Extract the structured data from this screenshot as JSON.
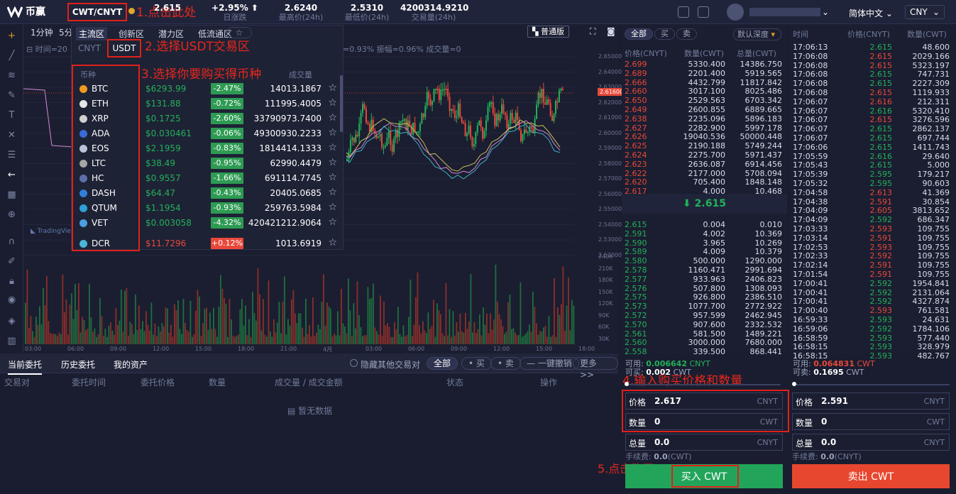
{
  "header": {
    "logo_text": "币赢",
    "pair": "CWT/CNYT",
    "last_price": "2.615",
    "change": "+2.95%",
    "change_label": "日涨跌",
    "high": "2.6240",
    "high_label": "最高价(24h)",
    "low": "2.5310",
    "low_label": "最低价(24h)",
    "volume": "4200314.9210",
    "volume_label": "交易量(24h)",
    "language": "简体中文",
    "currency": "CNY"
  },
  "annotations": {
    "step1": "1.点击此处",
    "step2": "2.选择USDT交易区",
    "step3": "3.选择你要购买得币种",
    "step4": "4.输入购买价格和数量",
    "step5": "5.点击购买"
  },
  "chart": {
    "timeframes": [
      "1分钟",
      "5分"
    ],
    "view_button": "普通版",
    "info_prefix": "时间=20",
    "ohlc_info": "=0.93%  振幅=0.96%  成交量=0",
    "current_price_tag": "2.61600",
    "price_axis": [
      "2.65000",
      "2.64000",
      "2.63000",
      "2.62000",
      "2.61000",
      "2.60000",
      "2.59000",
      "2.58000",
      "2.57000",
      "2.56000",
      "2.55000",
      "2.54000",
      "2.53000",
      "2.52000"
    ],
    "vol_axis": [
      "240K",
      "210K",
      "180K",
      "150K",
      "120K",
      "90K",
      "60K",
      "30K"
    ],
    "time_axis": [
      "03:00",
      "06:00",
      "09:00",
      "12:00",
      "15:00",
      "18:00",
      "21:00",
      "4月",
      "03:00",
      "06:00",
      "09:00",
      "12:00",
      "15:00",
      "18:00"
    ],
    "tv_logo": "TradingView"
  },
  "market": {
    "tabs": [
      "主流区",
      "创新区",
      "潜力区",
      "低流通区"
    ],
    "subtabs": [
      "CNYT",
      "USDT"
    ],
    "col_coin": "币种",
    "col_volume": "成交量",
    "rows": [
      {
        "name": "BTC",
        "price": "$6293.99",
        "change": "-2.47%",
        "volume": "14013.1867",
        "dir": "down",
        "color": "#f09a20"
      },
      {
        "name": "ETH",
        "price": "$131.88",
        "change": "-0.72%",
        "volume": "111995.4005",
        "dir": "down",
        "color": "#e6e6e6"
      },
      {
        "name": "XRP",
        "price": "$0.1725",
        "change": "-2.60%",
        "volume": "33790973.7400",
        "dir": "down",
        "color": "#d0d0d0"
      },
      {
        "name": "ADA",
        "price": "$0.030461",
        "change": "-0.06%",
        "volume": "49300930.2233",
        "dir": "down",
        "color": "#3a6bd8"
      },
      {
        "name": "EOS",
        "price": "$2.1959",
        "change": "-0.83%",
        "volume": "1814414.1333",
        "dir": "down",
        "color": "#b9c2d8"
      },
      {
        "name": "LTC",
        "price": "$38.49",
        "change": "-0.95%",
        "volume": "62990.4479",
        "dir": "down",
        "color": "#a6a6a6"
      },
      {
        "name": "HC",
        "price": "$0.9557",
        "change": "-1.66%",
        "volume": "691114.7745",
        "dir": "down",
        "color": "#5d6fa8"
      },
      {
        "name": "DASH",
        "price": "$64.47",
        "change": "-0.43%",
        "volume": "20405.0685",
        "dir": "down",
        "color": "#2f7fd6"
      },
      {
        "name": "QTUM",
        "price": "$1.1954",
        "change": "-0.93%",
        "volume": "259763.5984",
        "dir": "down",
        "color": "#2e9fd8"
      },
      {
        "name": "VET",
        "price": "$0.003058",
        "change": "-4.32%",
        "volume": "420421212.9064",
        "dir": "down",
        "color": "#4a9fe0"
      },
      {
        "name": "DCR",
        "price": "$11.7296",
        "change": "+0.12%",
        "volume": "1013.6919",
        "dir": "up",
        "color": "#4bb5d6"
      }
    ]
  },
  "bottom": {
    "tabs": [
      "当前委托",
      "历史委托",
      "我的资产"
    ],
    "hide_others": "隐藏其他交易对",
    "filters": [
      "全部",
      "买",
      "卖",
      "一键撤销",
      "更多>>"
    ],
    "columns": [
      "交易对",
      "委托时间",
      "委托价格",
      "数量",
      "成交量 / 成交金额",
      "状态",
      "操作"
    ],
    "no_data": "暂无数据"
  },
  "orderbook": {
    "tabs": [
      "全部",
      "买",
      "卖"
    ],
    "depth": "默认深度",
    "headers": [
      "价格(CNYT)",
      "数量(CWT)",
      "总量(CWT)"
    ],
    "asks": [
      [
        "2.699",
        "5330.400",
        "14386.750"
      ],
      [
        "2.689",
        "2201.400",
        "5919.565"
      ],
      [
        "2.666",
        "4432.799",
        "11817.842"
      ],
      [
        "2.660",
        "3017.100",
        "8025.486"
      ],
      [
        "2.650",
        "2529.563",
        "6703.342"
      ],
      [
        "2.649",
        "2600.855",
        "6889.665"
      ],
      [
        "2.638",
        "2235.096",
        "5896.183"
      ],
      [
        "2.627",
        "2282.900",
        "5997.178"
      ],
      [
        "2.626",
        "19040.536",
        "50000.448"
      ],
      [
        "2.625",
        "2190.188",
        "5749.244"
      ],
      [
        "2.624",
        "2275.700",
        "5971.437"
      ],
      [
        "2.623",
        "2636.087",
        "6914.456"
      ],
      [
        "2.622",
        "2177.000",
        "5708.094"
      ],
      [
        "2.620",
        "705.400",
        "1848.148"
      ],
      [
        "2.617",
        "4.000",
        "10.468"
      ]
    ],
    "mid": "2.615",
    "bids": [
      [
        "2.615",
        "0.004",
        "0.010"
      ],
      [
        "2.591",
        "4.002",
        "10.369"
      ],
      [
        "2.590",
        "3.965",
        "10.269"
      ],
      [
        "2.589",
        "4.009",
        "10.379"
      ],
      [
        "2.580",
        "500.000",
        "1290.000"
      ],
      [
        "2.578",
        "1160.471",
        "2991.694"
      ],
      [
        "2.577",
        "933.963",
        "2406.823"
      ],
      [
        "2.576",
        "507.800",
        "1308.093"
      ],
      [
        "2.575",
        "926.800",
        "2386.510"
      ],
      [
        "2.573",
        "1077.700",
        "2772.922"
      ],
      [
        "2.572",
        "957.599",
        "2462.945"
      ],
      [
        "2.570",
        "907.600",
        "2332.532"
      ],
      [
        "2.561",
        "581.500",
        "1489.221"
      ],
      [
        "2.560",
        "3000.000",
        "7680.000"
      ],
      [
        "2.558",
        "339.500",
        "868.441"
      ]
    ]
  },
  "trades": {
    "headers": [
      "时间",
      "价格(CNYT)",
      "数量(CWT)"
    ],
    "rows": [
      [
        "17:06:13",
        "2.615",
        "48.600",
        "g"
      ],
      [
        "17:06:08",
        "2.615",
        "2029.166",
        "r"
      ],
      [
        "17:06:08",
        "2.615",
        "5323.197",
        "r"
      ],
      [
        "17:06:08",
        "2.615",
        "747.731",
        "g"
      ],
      [
        "17:06:08",
        "2.615",
        "2227.309",
        "g"
      ],
      [
        "17:06:08",
        "2.615",
        "1119.933",
        "r"
      ],
      [
        "17:06:07",
        "2.616",
        "212.311",
        "r"
      ],
      [
        "17:06:07",
        "2.616",
        "5320.410",
        "g"
      ],
      [
        "17:06:07",
        "2.615",
        "3276.596",
        "r"
      ],
      [
        "17:06:07",
        "2.615",
        "2862.137",
        "g"
      ],
      [
        "17:06:07",
        "2.615",
        "697.744",
        "g"
      ],
      [
        "17:06:06",
        "2.615",
        "1411.743",
        "g"
      ],
      [
        "17:05:59",
        "2.616",
        "29.640",
        "g"
      ],
      [
        "17:05:43",
        "2.615",
        "5.000",
        "g"
      ],
      [
        "17:05:39",
        "2.595",
        "179.217",
        "g"
      ],
      [
        "17:05:32",
        "2.595",
        "90.603",
        "g"
      ],
      [
        "17:04:58",
        "2.613",
        "41.369",
        "r"
      ],
      [
        "17:04:38",
        "2.591",
        "30.854",
        "r"
      ],
      [
        "17:04:09",
        "2.605",
        "3813.652",
        "r"
      ],
      [
        "17:04:09",
        "2.592",
        "686.347",
        "g"
      ],
      [
        "17:03:33",
        "2.593",
        "109.755",
        "r"
      ],
      [
        "17:03:14",
        "2.591",
        "109.755",
        "r"
      ],
      [
        "17:02:53",
        "2.593",
        "109.755",
        "r"
      ],
      [
        "17:02:33",
        "2.592",
        "109.755",
        "r"
      ],
      [
        "17:02:14",
        "2.591",
        "109.755",
        "r"
      ],
      [
        "17:01:54",
        "2.591",
        "109.755",
        "r"
      ],
      [
        "17:00:41",
        "2.592",
        "1954.841",
        "g"
      ],
      [
        "17:00:41",
        "2.592",
        "2131.064",
        "g"
      ],
      [
        "17:00:41",
        "2.592",
        "4327.874",
        "g"
      ],
      [
        "17:00:40",
        "2.593",
        "761.581",
        "r"
      ],
      [
        "16:59:33",
        "2.593",
        "24.631",
        "g"
      ],
      [
        "16:59:06",
        "2.592",
        "1784.106",
        "g"
      ],
      [
        "16:58:59",
        "2.593",
        "577.440",
        "g"
      ],
      [
        "16:58:15",
        "2.593",
        "328.979",
        "g"
      ],
      [
        "16:58:15",
        "2.593",
        "482.767",
        "g"
      ]
    ]
  },
  "buy_form": {
    "available_label": "可用:",
    "available_value": "0.006642",
    "available_unit": "CNYT",
    "can_buy_label": "可买:",
    "can_buy_value": "0.002",
    "can_buy_unit": "CWT",
    "price_label": "价格",
    "price_value": "2.617",
    "price_unit": "CNYT",
    "qty_label": "数量",
    "qty_value": "0",
    "qty_unit": "CWT",
    "total_label": "总量",
    "total_value": "0.0",
    "total_unit": "CNYT",
    "fee_label": "手续费:",
    "fee_value": "0.0",
    "fee_unit": "(CWT)",
    "button": "买入 CWT"
  },
  "sell_form": {
    "available_label": "可用:",
    "available_value": "0.064831",
    "available_unit": "CWT",
    "can_sell_label": "可卖:",
    "can_sell_value": "0.1695",
    "can_sell_unit": "CWT",
    "price_label": "价格",
    "price_value": "2.591",
    "price_unit": "CNYT",
    "qty_label": "数量",
    "qty_value": "0",
    "qty_unit": "CWT",
    "total_label": "总量",
    "total_value": "0.0",
    "total_unit": "CNYT",
    "fee_label": "手续费:",
    "fee_value": "0.0",
    "fee_unit": "(CNYT)",
    "button": "卖出 CWT"
  },
  "colors": {
    "up": "#e8483a",
    "down": "#22b15a",
    "bg": "#1a1d2f",
    "annotation": "#e0201b"
  }
}
